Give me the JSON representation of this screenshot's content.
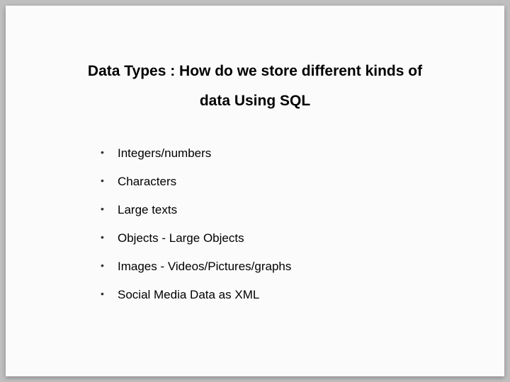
{
  "slide": {
    "title_line1": "Data Types : How do we store different kinds of",
    "title_line2": "data Using SQL",
    "bullets": [
      "Integers/numbers",
      "Characters",
      "Large texts",
      "Objects - Large Objects",
      "Images - Videos/Pictures/graphs",
      "Social Media Data as XML"
    ]
  }
}
